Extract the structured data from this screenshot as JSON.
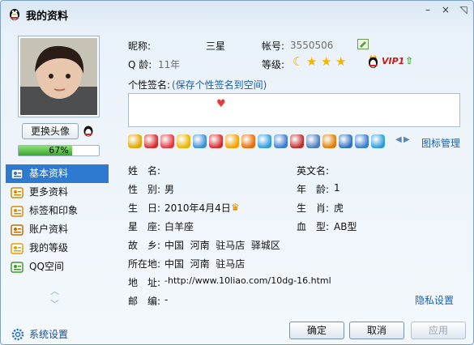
{
  "window": {
    "title": "我的资料",
    "min": "–",
    "close": "×",
    "max": "◹"
  },
  "sidebar": {
    "change_avatar": "更换头像",
    "progress_label": "67%",
    "progress_value": 0.67,
    "items": [
      {
        "label": "基本资料",
        "icon": "id-card-icon",
        "active": true
      },
      {
        "label": "更多资料",
        "icon": "id-stack-icon",
        "active": false
      },
      {
        "label": "标签和印象",
        "icon": "tag-icon",
        "active": false
      },
      {
        "label": "账户资料",
        "icon": "user-card-icon",
        "active": false
      },
      {
        "label": "我的等级",
        "icon": "star-badge-icon",
        "active": false
      },
      {
        "label": "QQ空间",
        "icon": "qzone-icon",
        "active": false
      }
    ],
    "settings": "系统设置"
  },
  "profile": {
    "nick_label": "昵称:",
    "nick": "三星",
    "account_label": "帐号:",
    "account": "3550506",
    "qage_label": "Q 龄:",
    "qage": "11年",
    "level_label": "等级:",
    "vip": "VIP1",
    "sig_label": "个性签名:",
    "sig_link": "(保存个性签名到空间)",
    "sig_content": "♥",
    "icon_manage": "图标管理"
  },
  "details": {
    "name_label": "姓　名:",
    "name": "",
    "en_label": "英文名:",
    "en": "",
    "gender_label": "性　别:",
    "gender": "男",
    "age_label": "年　龄:",
    "age": "1",
    "birthday_label": "生　日:",
    "birthday": "2010年4月4日",
    "zodiac_label": "生　肖:",
    "zodiac": "虎",
    "star_label": "星　座:",
    "star": "白羊座",
    "blood_label": "血　型:",
    "blood": "AB型",
    "hometown_label": "故　乡:",
    "hometown": "中国  河南  驻马店  驿城区",
    "location_label": "所在地:",
    "location": "中国  河南  驻马店",
    "address_label": "地　址:",
    "address": "-http://www.10liao.com/10dg-16.html",
    "zip_label": "邮　编:",
    "zip": "-",
    "privacy": "隐私设置"
  },
  "footer": {
    "ok": "确定",
    "cancel": "取消",
    "apply": "应用"
  },
  "colors": {
    "accent": "#2d7ad0",
    "link": "#1c5fb0",
    "progress": "#3aa52c"
  }
}
